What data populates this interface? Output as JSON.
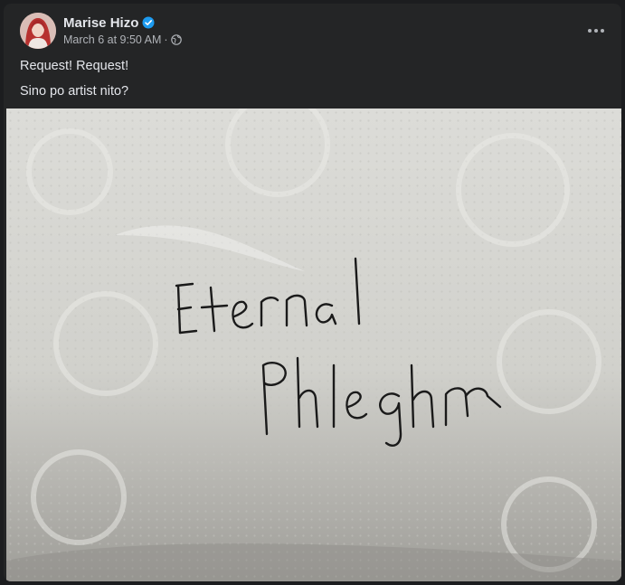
{
  "post": {
    "author": "Marise Hizo",
    "verified": true,
    "timestamp": "March 6 at 9:50 AM",
    "separator": "·",
    "audience_icon": "globe-icon",
    "more_icon": "more-horizontal-icon",
    "text_lines": [
      "Request! Request!",
      "Sino po artist nito?"
    ],
    "photo": {
      "description_icon": "photo",
      "handwritten_text": [
        "Eternal",
        "Phlegm"
      ]
    }
  },
  "colors": {
    "background": "#1c1d1f",
    "card": "#242526",
    "primary_text": "#e4e6eb",
    "secondary_text": "#b0b3b8",
    "verified_blue": "#1d9bf0"
  }
}
